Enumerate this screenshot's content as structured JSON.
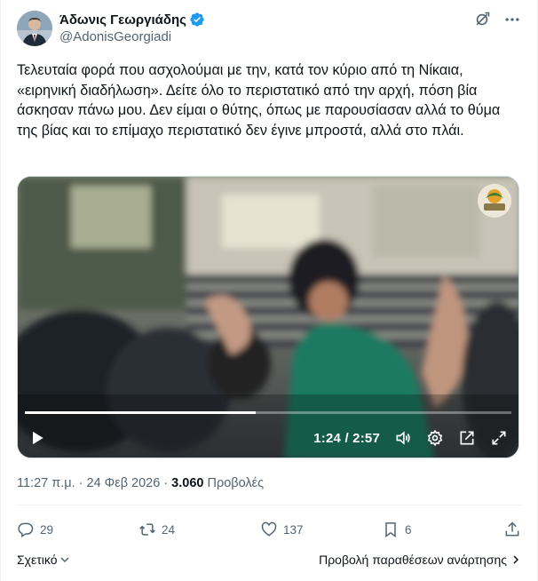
{
  "author": {
    "display_name": "Άδωνις Γεωργιάδης",
    "handle": "@AdonisGeorgiadi",
    "verified": true
  },
  "tweet": {
    "text": "Τελευταία φορά που ασχολούμαι με την, κατά τον κύριο από τη Νίκαια, «ειρηνική διαδήλωση». Δείτε όλο το περιστατικό από την αρχή, πόση βία άσκησαν πάνω μου. Δεν είμαι ο θύτης, όπως με παρουσίασαν αλλά το θύμα της βίας και το επίμαχο περιστατικό δεν έγινε μπροστά, αλλά στο πλάι."
  },
  "video": {
    "current_time": "1:24",
    "duration": "2:57",
    "time_display": "1:24 / 2:57",
    "progress_fraction": 0.474,
    "icons": [
      "play-icon",
      "volume-icon",
      "settings-icon",
      "picture-in-picture-icon",
      "fullscreen-icon"
    ]
  },
  "meta": {
    "time": "11:27 π.μ.",
    "date": "24 Φεβ 2026",
    "separator": "·",
    "views_count": "3.060",
    "views_label": "Προβολές"
  },
  "actions": {
    "replies": "29",
    "retweets": "24",
    "likes": "137",
    "bookmarks": "6"
  },
  "footer": {
    "relevant_label": "Σχετικό",
    "engagements_label": "Προβολή παραθέσεων ανάρτησης"
  },
  "colors": {
    "verified_blue": "#1d9bf0",
    "secondary_text": "#536471",
    "primary_text": "#0f1419"
  }
}
